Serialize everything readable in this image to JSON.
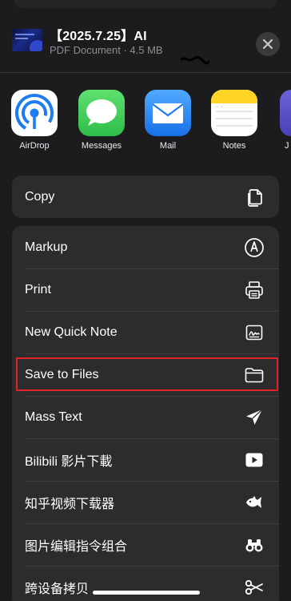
{
  "header": {
    "title": "【2025.7.25】AI",
    "subtitle": "PDF Document · 4.5 MB",
    "close_icon": "close-icon"
  },
  "apps": [
    {
      "label": "AirDrop",
      "icon": "airdrop-icon"
    },
    {
      "label": "Messages",
      "icon": "messages-icon"
    },
    {
      "label": "Mail",
      "icon": "mail-icon"
    },
    {
      "label": "Notes",
      "icon": "notes-icon"
    },
    {
      "label": "J",
      "icon": "app-icon"
    }
  ],
  "group1": [
    {
      "label": "Copy",
      "icon": "copy-icon"
    }
  ],
  "group2": [
    {
      "label": "Markup",
      "icon": "markup-icon"
    },
    {
      "label": "Print",
      "icon": "printer-icon"
    },
    {
      "label": "New Quick Note",
      "icon": "quick-note-icon"
    },
    {
      "label": "Save to Files",
      "icon": "folder-icon",
      "highlighted": true
    },
    {
      "label": "Mass Text",
      "icon": "paper-plane-icon"
    },
    {
      "label": "Bilibili 影片下載",
      "icon": "play-icon"
    },
    {
      "label": "知乎视频下载器",
      "icon": "fish-icon"
    },
    {
      "label": "图片编辑指令组合",
      "icon": "binoculars-icon"
    },
    {
      "label": "跨设备拷贝",
      "icon": "scissors-icon"
    }
  ],
  "colors": {
    "background": "#1c1c1e",
    "group": "#2c2c2e",
    "highlight": "#e0232a",
    "messages_green": "#34c759",
    "mail_blue": "#1e7cf2",
    "notes_yellow": "#ffd426"
  }
}
